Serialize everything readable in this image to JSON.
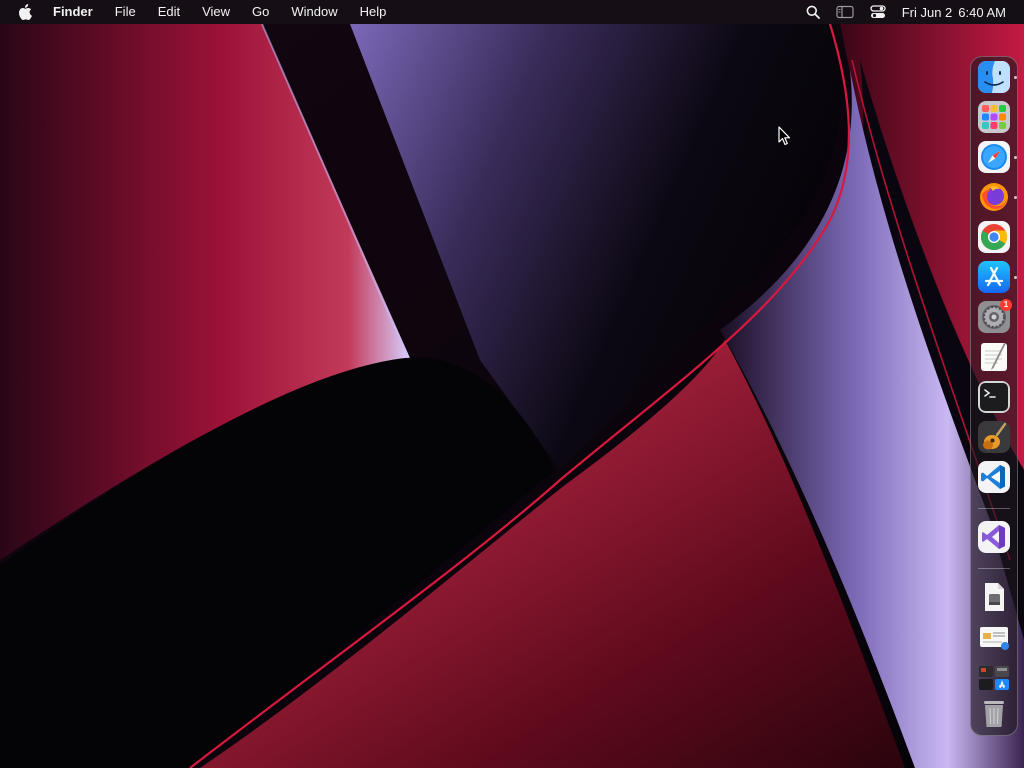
{
  "menubar": {
    "apple_icon": "apple-logo-icon",
    "app_name": "Finder",
    "menus": [
      "File",
      "Edit",
      "View",
      "Go",
      "Window",
      "Help"
    ],
    "status_icons": [
      "search-icon",
      "sidebar-icon",
      "control-center-icon"
    ],
    "date": "Fri Jun 2",
    "time": "6:40 AM"
  },
  "dock": {
    "items": [
      {
        "icon": "finder-icon",
        "running": true
      },
      {
        "icon": "launchpad-icon",
        "running": false
      },
      {
        "icon": "safari-icon",
        "running": true
      },
      {
        "icon": "firefox-icon",
        "running": true
      },
      {
        "icon": "chrome-icon",
        "running": false
      },
      {
        "icon": "app-store-icon",
        "running": true
      },
      {
        "icon": "system-settings-icon",
        "running": false,
        "badge": "1"
      },
      {
        "icon": "textedit-icon",
        "running": false
      },
      {
        "icon": "terminal-icon",
        "running": false
      },
      {
        "icon": "garageband-icon",
        "running": false
      },
      {
        "icon": "vscode-icon",
        "running": false
      },
      {
        "icon": "visual-studio-icon",
        "running": false
      },
      {
        "icon": "disk-image-icon",
        "running": false
      },
      {
        "icon": "documents-stack-icon",
        "running": false
      },
      {
        "icon": "applications-stack-icon",
        "running": false
      },
      {
        "icon": "trash-icon",
        "running": false
      }
    ]
  },
  "colors": {
    "menubar_bg": "#161016",
    "wallpaper_red": "#a3133a",
    "wallpaper_purple": "#9d8ae0",
    "wallpaper_black": "#050308",
    "badge_red": "#ff3b30"
  }
}
